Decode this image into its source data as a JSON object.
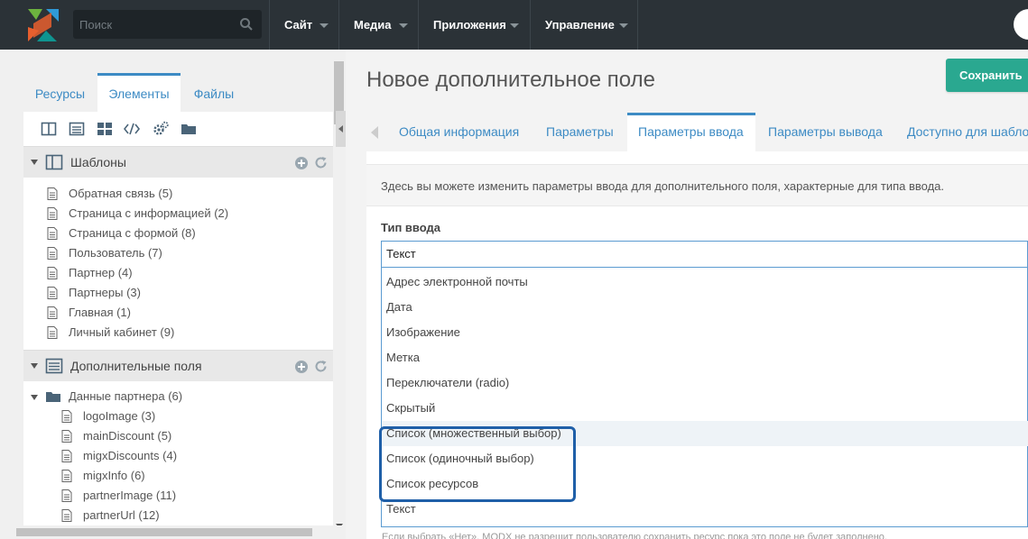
{
  "topbar": {
    "search": {
      "placeholder": "Поиск"
    },
    "menu": [
      {
        "label": "Сайт"
      },
      {
        "label": "Медиа"
      },
      {
        "label": "Приложения"
      },
      {
        "label": "Управление"
      }
    ],
    "colors": {
      "bar": "#2b3237",
      "logo_green": "#6cb33f",
      "logo_red": "#e85f2e",
      "logo_blue": "#2f9ad8",
      "logo_teal": "#0f9490"
    }
  },
  "left_panel": {
    "tabs": [
      {
        "label": "Ресурсы",
        "active": false
      },
      {
        "label": "Элементы",
        "active": true
      },
      {
        "label": "Файлы",
        "active": false
      }
    ],
    "toolbar_icons": [
      "template-icon",
      "tv-icon",
      "chunk-icon",
      "snippet-icon",
      "plugin-icon",
      "category-icon"
    ],
    "templates": {
      "title": "Шаблоны",
      "items": [
        "Обратная связь (5)",
        "Страница с информацией (2)",
        "Страница с формой (8)",
        "Пользователь (7)",
        "Партнер (4)",
        "Партнеры (3)",
        "Главная (1)",
        "Личный кабинет (9)"
      ]
    },
    "tvs": {
      "title": "Дополнительные поля",
      "category": "Данные партнера (6)",
      "items": [
        "logoImage (3)",
        "mainDiscount (5)",
        "migxDiscounts (4)",
        "migxInfo (6)",
        "partnerImage (11)",
        "partnerUrl (12)"
      ]
    }
  },
  "main": {
    "title": "Новое дополнительное поле",
    "save_label": "Сохранить",
    "tabs": [
      {
        "label": "Общая информация",
        "active": false
      },
      {
        "label": "Параметры",
        "active": false
      },
      {
        "label": "Параметры ввода",
        "active": true
      },
      {
        "label": "Параметры вывода",
        "active": false
      },
      {
        "label": "Доступно для шабло",
        "active": false
      }
    ],
    "intro": "Здесь вы можете изменить параметры ввода для дополнительного поля, характерные для типа ввода.",
    "input_type_label": "Тип ввода",
    "input_type_value": "Текст",
    "options": [
      "Адрес электронной почты",
      "Дата",
      "Изображение",
      "Метка",
      "Переключатели (radio)",
      "Скрытый",
      "Список (множественный выбор)",
      "Список (одиночный выбор)",
      "Список ресурсов",
      "Текст"
    ],
    "highlighted_option": "Список (множественный выбор)",
    "hint": "Если выбрать «Нет», MODX не разрешит пользователю сохранить ресурс пока это поле не будет заполнено."
  }
}
